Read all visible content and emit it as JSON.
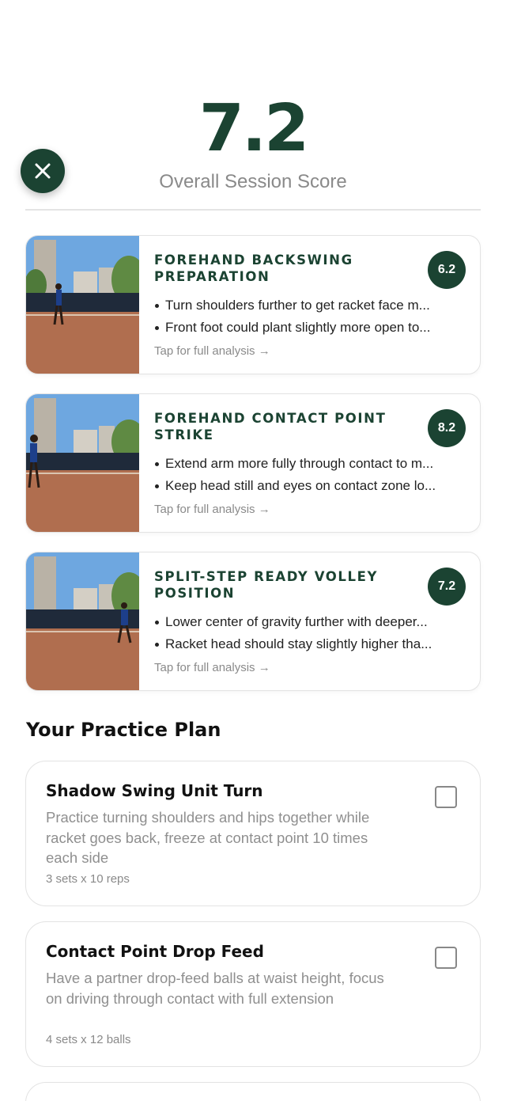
{
  "overall": {
    "score": "7.2",
    "label": "Overall Session Score"
  },
  "colors": {
    "brand": "#1b4332",
    "muted": "#8a8a8a"
  },
  "strokes": [
    {
      "title": "FOREHAND BACKSWING PREPARATION",
      "score": "6.2",
      "bullets": [
        "Turn shoulders further to get racket face m...",
        "Front foot could plant slightly more open to..."
      ],
      "cta": "Tap for full analysis →"
    },
    {
      "title": "FOREHAND CONTACT POINT STRIKE",
      "score": "8.2",
      "bullets": [
        "Extend arm more fully through contact to m...",
        "Keep head still and eyes on contact zone lo..."
      ],
      "cta": "Tap for full analysis →"
    },
    {
      "title": "SPLIT-STEP READY VOLLEY POSITION",
      "score": "7.2",
      "bullets": [
        "Lower center of gravity further with deeper...",
        "Racket head should stay slightly higher tha..."
      ],
      "cta": "Tap for full analysis →"
    }
  ],
  "plan": {
    "heading": "Your Practice Plan",
    "items": [
      {
        "title": "Shadow Swing Unit Turn",
        "description": "Practice turning shoulders and hips together while racket goes back, freeze at contact point 10 times each side",
        "meta": "3 sets x 10 reps",
        "checked": false
      },
      {
        "title": "Contact Point Drop Feed",
        "description": "Have a partner drop-feed balls at waist height, focus on driving through contact with full extension",
        "meta": "4 sets x 12 balls",
        "checked": false
      }
    ]
  }
}
